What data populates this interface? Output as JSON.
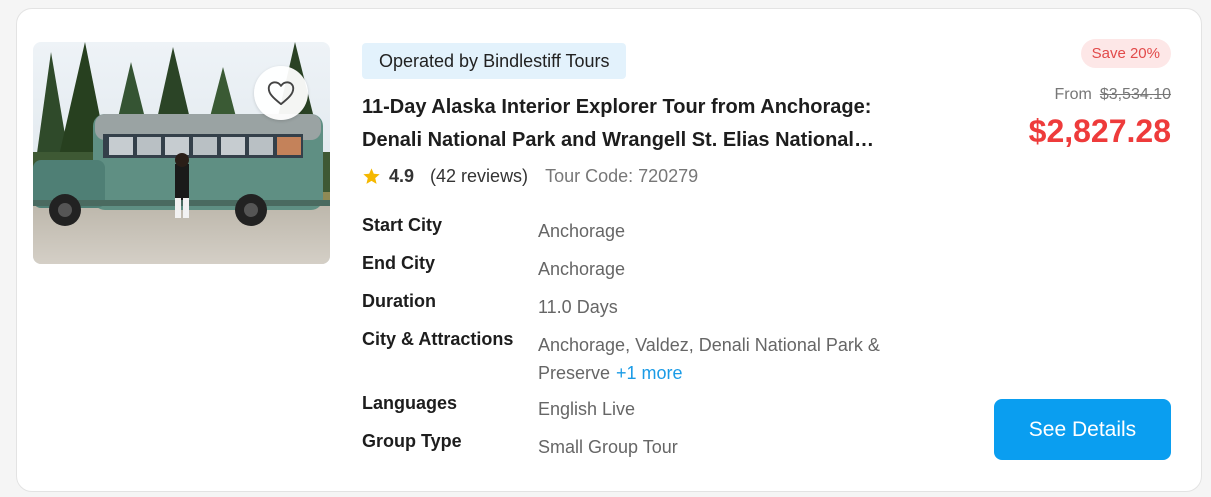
{
  "listing": {
    "operator_label": "Operated by Bindlestiff Tours",
    "title_line1": "11-Day Alaska Interior Explorer Tour from Anchorage:",
    "title_line2": "Denali National Park and Wrangell St. Elias National…",
    "favorite_icon": "heart-outline-icon",
    "rating": {
      "star_icon": "star-icon",
      "star_color": "#f5b800",
      "score": "4.9",
      "reviews": "(42 reviews)",
      "tour_code": "Tour Code: 720279"
    },
    "details": [
      {
        "label": "Start City",
        "value": "Anchorage"
      },
      {
        "label": "End City",
        "value": "Anchorage"
      },
      {
        "label": "Duration",
        "value": "11.0 Days"
      },
      {
        "label": "City & Attractions",
        "value_line1": "Anchorage, Valdez, Denali National Park &",
        "value_line2": "Preserve",
        "more": "+1 more"
      },
      {
        "label": "Languages",
        "value": "English Live"
      },
      {
        "label": "Group Type",
        "value": "Small Group Tour"
      }
    ]
  },
  "pricing": {
    "save_badge": "Save 20%",
    "from_label": "From",
    "original_price": "$3,534.10",
    "price": "$2,827.28",
    "price_color": "#ee3b3b"
  },
  "cta": {
    "label": "See Details",
    "color": "#0a9ef0"
  }
}
